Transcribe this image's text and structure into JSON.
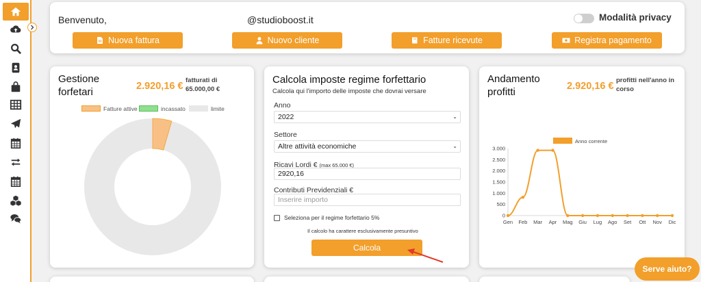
{
  "header": {
    "welcome": "Benvenuto,",
    "email_domain": "@studioboost.it",
    "privacy_label": "Modalità privacy",
    "buttons": {
      "new_invoice": "Nuova fattura",
      "new_client": "Nuovo cliente",
      "received_invoices": "Fatture ricevute",
      "register_payment": "Registra pagamento"
    }
  },
  "gestione": {
    "title_line1": "Gestione",
    "title_line2": "forfetari",
    "amount": "2.920,16 €",
    "note_line1": "fatturati di",
    "note_line2": "65.000,00 €",
    "legend": [
      "Fatture attive",
      "incassato",
      "limite"
    ],
    "colors": {
      "active": "#f8c085",
      "incassato": "#8ee08e",
      "limite": "#e8e8e8"
    }
  },
  "calcola": {
    "title": "Calcola imposte regime forfettario",
    "subtitle": "Calcola qui l'importo delle imposte che dovrai versare",
    "anno_label": "Anno",
    "anno_value": "2022",
    "settore_label": "Settore",
    "settore_value": "Altre attività economiche",
    "ricavi_label": "Ricavi Lordi €",
    "ricavi_max": "(max 65.000 €)",
    "ricavi_value": "2920,16",
    "contributi_label": "Contributi Previdenziali €",
    "contributi_placeholder": "Inserire importo",
    "checkbox_label": "Seleziona per il regime forfettario 5%",
    "disclaimer": "Il calcolo ha carattere esclusivamente presuntivo",
    "submit": "Calcola"
  },
  "andamento": {
    "title_line1": "Andamento",
    "title_line2": "profitti",
    "amount": "2.920,16 €",
    "note_line1": "profitti nell'anno in",
    "note_line2": "corso"
  },
  "chart_data": {
    "type": "line",
    "categories": [
      "Gen",
      "Feb",
      "Mar",
      "Apr",
      "Mag",
      "Giu",
      "Lug",
      "Ago",
      "Set",
      "Ott",
      "Nov",
      "Dic"
    ],
    "series": [
      {
        "name": "Anno corrente",
        "values": [
          0,
          820,
          2920,
          2920,
          0,
          0,
          0,
          0,
          0,
          0,
          0,
          0
        ]
      }
    ],
    "yticks": [
      "0",
      "500",
      "1.000",
      "1.500",
      "2.000",
      "2.500",
      "3.000"
    ],
    "ylim": [
      0,
      3000
    ],
    "color": "#f29f2b"
  },
  "help_button": "Serve aiuto?",
  "colors": {
    "accent": "#f29f2b"
  }
}
